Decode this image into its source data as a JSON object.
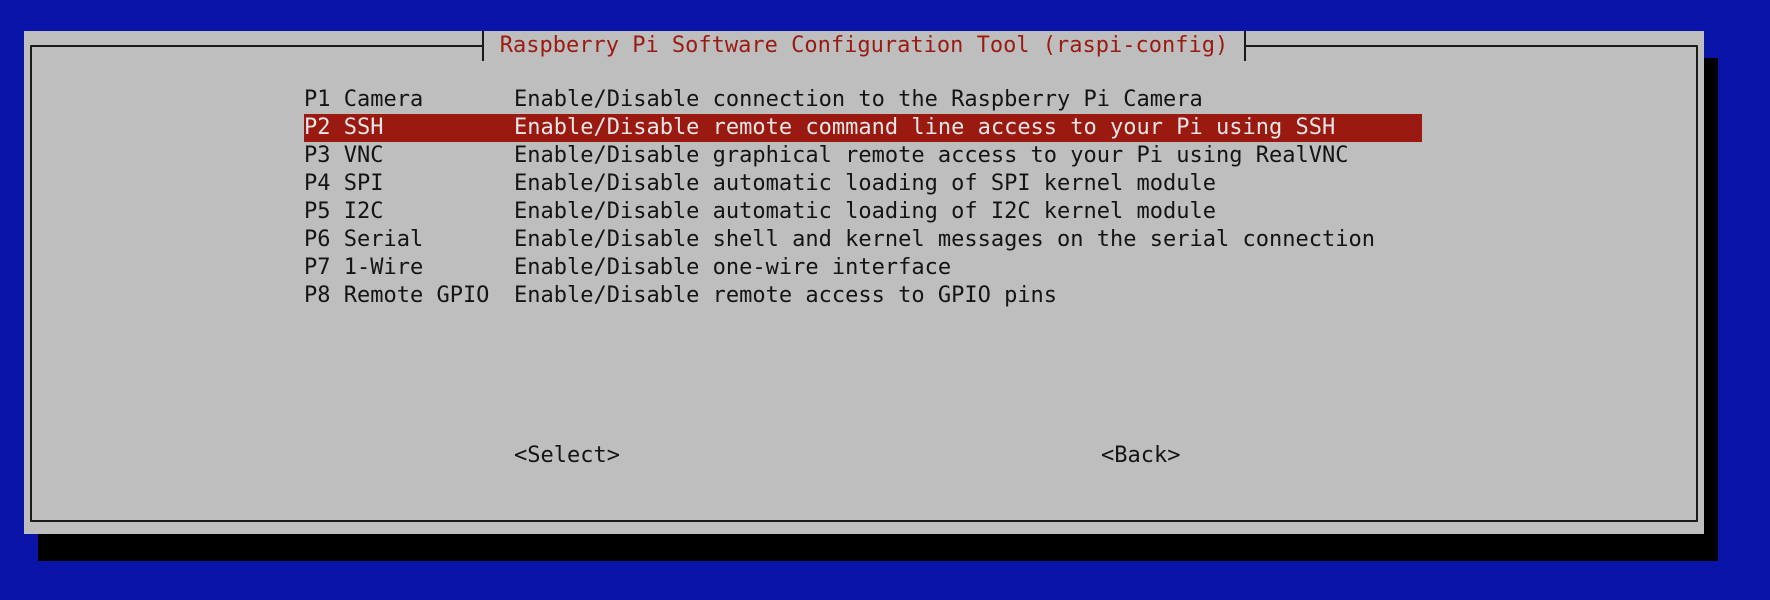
{
  "dialog": {
    "title": "Raspberry Pi Software Configuration Tool (raspi-config)"
  },
  "menu": {
    "selected_index": 1,
    "items": [
      {
        "key": "P1 Camera",
        "desc": "Enable/Disable connection to the Raspberry Pi Camera"
      },
      {
        "key": "P2 SSH",
        "desc": "Enable/Disable remote command line access to your Pi using SSH"
      },
      {
        "key": "P3 VNC",
        "desc": "Enable/Disable graphical remote access to your Pi using RealVNC"
      },
      {
        "key": "P4 SPI",
        "desc": "Enable/Disable automatic loading of SPI kernel module"
      },
      {
        "key": "P5 I2C",
        "desc": "Enable/Disable automatic loading of I2C kernel module"
      },
      {
        "key": "P6 Serial",
        "desc": "Enable/Disable shell and kernel messages on the serial connection"
      },
      {
        "key": "P7 1-Wire",
        "desc": "Enable/Disable one-wire interface"
      },
      {
        "key": "P8 Remote GPIO",
        "desc": "Enable/Disable remote access to GPIO pins"
      }
    ]
  },
  "buttons": {
    "select_label": "<Select>",
    "back_label": "<Back>"
  },
  "colors": {
    "background": "#0a14a8",
    "dialog": "#bebebe",
    "highlight": "#9a1a12",
    "title_text": "#9a1a12"
  }
}
